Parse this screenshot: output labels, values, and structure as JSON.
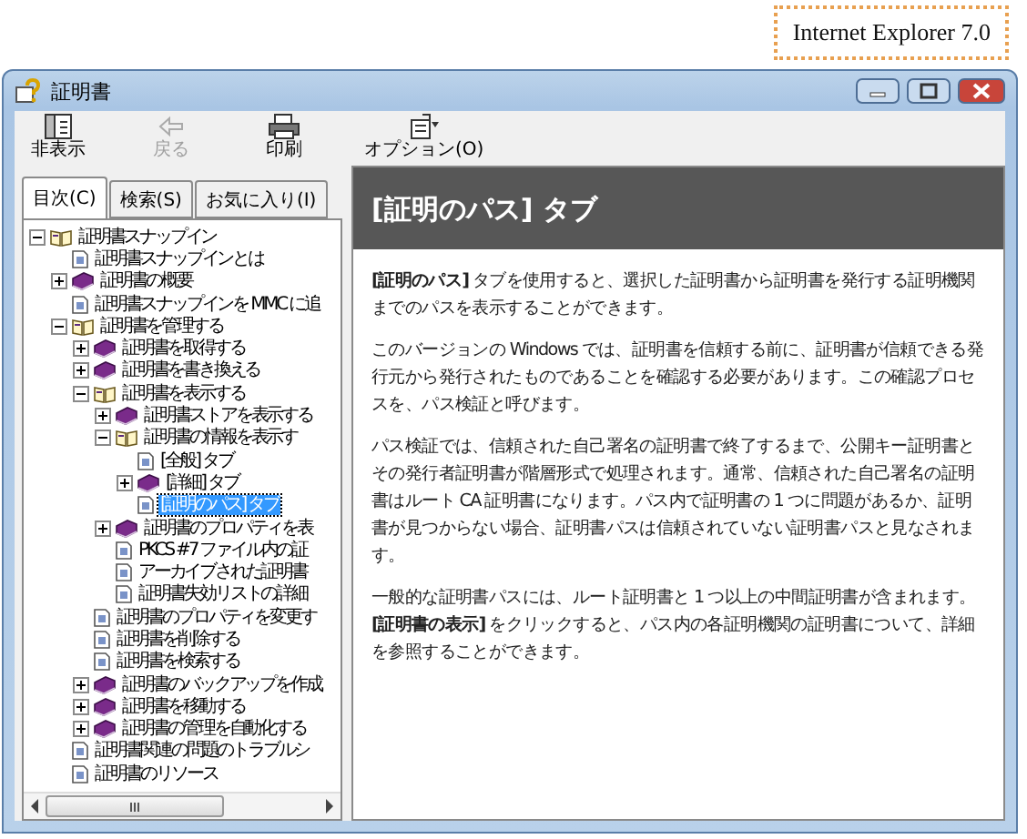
{
  "note": {
    "text": "Internet Explorer 7.0"
  },
  "window": {
    "title": "証明書"
  },
  "toolbar": [
    {
      "label": "非表示",
      "kind": "hide",
      "disabled": false
    },
    {
      "label": "戻る",
      "kind": "back",
      "disabled": true
    },
    {
      "label": "印刷",
      "kind": "print",
      "disabled": false
    },
    {
      "label": "オプション(O)",
      "kind": "options",
      "disabled": false
    }
  ],
  "tabs": [
    {
      "label": "目次(C)",
      "selected": true
    },
    {
      "label": "検索(S)",
      "selected": false
    },
    {
      "label": "お気に入り(I)",
      "selected": false
    }
  ],
  "tree": [
    {
      "label": "証明書スナップイン",
      "kind": "book",
      "expanded": true,
      "selected": false,
      "children": [
        {
          "label": "証明書スナップインとは",
          "kind": "page",
          "selected": false
        },
        {
          "label": "証明書の概要",
          "kind": "book",
          "expanded": false,
          "selected": false
        },
        {
          "label": "証明書スナップインを MMC に追",
          "kind": "page",
          "selected": false
        },
        {
          "label": "証明書を管理する",
          "kind": "book",
          "expanded": true,
          "selected": false,
          "children": [
            {
              "label": "証明書を取得する",
              "kind": "book",
              "expanded": false,
              "selected": false
            },
            {
              "label": "証明書を書き換える",
              "kind": "book",
              "expanded": false,
              "selected": false
            },
            {
              "label": "証明書を表示する",
              "kind": "book",
              "expanded": true,
              "selected": false,
              "children": [
                {
                  "label": "証明書ストアを表示する",
                  "kind": "book",
                  "expanded": false,
                  "selected": false
                },
                {
                  "label": "証明書の情報を表示す",
                  "kind": "book",
                  "expanded": true,
                  "selected": false,
                  "children": [
                    {
                      "label": "[全般] タブ",
                      "kind": "page",
                      "selected": false
                    },
                    {
                      "label": "[詳細] タブ",
                      "kind": "book",
                      "expanded": false,
                      "selected": false
                    },
                    {
                      "label": "[証明のパス] タブ",
                      "kind": "page",
                      "selected": true
                    }
                  ]
                },
                {
                  "label": "証明書のプロパティを表",
                  "kind": "book",
                  "expanded": false,
                  "selected": false
                },
                {
                  "label": "PKCS #7 ファイル内の証",
                  "kind": "page",
                  "selected": false
                },
                {
                  "label": "アーカイブされた証明書",
                  "kind": "page",
                  "selected": false
                },
                {
                  "label": "証明書失効リストの詳細",
                  "kind": "page",
                  "selected": false
                }
              ]
            },
            {
              "label": "証明書のプロパティを変更す",
              "kind": "page",
              "selected": false
            },
            {
              "label": "証明書を削除する",
              "kind": "page",
              "selected": false
            },
            {
              "label": "証明書を検索する",
              "kind": "page",
              "selected": false
            },
            {
              "label": "証明書のバックアップを作成",
              "kind": "book",
              "expanded": false,
              "selected": false
            },
            {
              "label": "証明書を移動する",
              "kind": "book",
              "expanded": false,
              "selected": false
            },
            {
              "label": "証明書の管理を自動化する",
              "kind": "book",
              "expanded": false,
              "selected": false
            }
          ]
        },
        {
          "label": "証明書関連の問題のトラブルシ",
          "kind": "page",
          "selected": false
        },
        {
          "label": "証明書のリソース",
          "kind": "page",
          "selected": false
        }
      ]
    }
  ],
  "article": {
    "heading": "[証明のパス] タブ",
    "paragraphs": [
      "**[証明のパス]** タブを使用すると、選択した証明書から証明書を発行する証明機関までのパスを表示することができます。",
      "このバージョンの Windows では、証明書を信頼する前に、証明書が信頼できる発行元から発行されたものであることを確認する必要があります。この確認プロセスを、パス検証と呼びます。",
      "パス検証では、信頼された自己署名の証明書で終了するまで、公開キー証明書とその発行者証明書が階層形式で処理されます。通常、信頼された自己署名の証明書はルート CA 証明書になります。パス内で証明書の 1 つに問題があるか、証明書が見つからない場合、証明書パスは信頼されていない証明書パスと見なされます。",
      "一般的な証明書パスには、ルート証明書と 1 つ以上の中間証明書が含まれます。**[証明書の表示]** をクリックすると、パス内の各証明機関の証明書について、詳細を参照することができます。"
    ]
  }
}
